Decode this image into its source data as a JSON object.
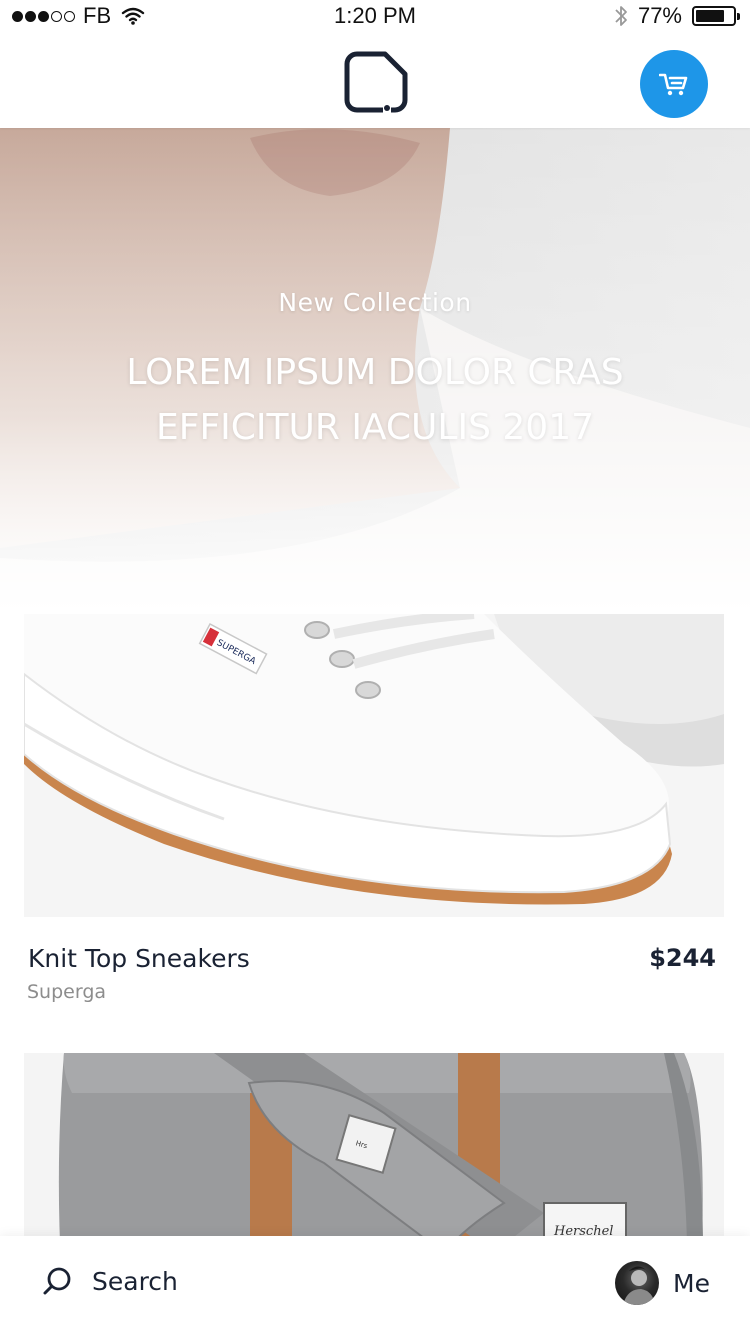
{
  "status_bar": {
    "carrier": "FB",
    "time": "1:20 PM",
    "battery_percent": "77%",
    "battery_level": 0.77,
    "signal_bars_filled": 3,
    "signal_bars_total": 5
  },
  "nav": {
    "logo_icon": "brand-logo-icon",
    "cart_icon": "cart-icon",
    "accent_color": "#1e96e8"
  },
  "hero": {
    "subtitle": "New Collection",
    "title": "LOREM IPSUM DOLOR CRAS EFFICITUR IACULIS 2017"
  },
  "products": [
    {
      "name": "Knit Top Sneakers",
      "brand": "Superga",
      "price": "$244",
      "image_label": "SUPERGA"
    },
    {
      "name": "",
      "brand": "",
      "price": "",
      "image_label": "Herschel"
    }
  ],
  "tab_bar": {
    "search_label": "Search",
    "me_label": "Me",
    "search_icon": "search-icon"
  }
}
